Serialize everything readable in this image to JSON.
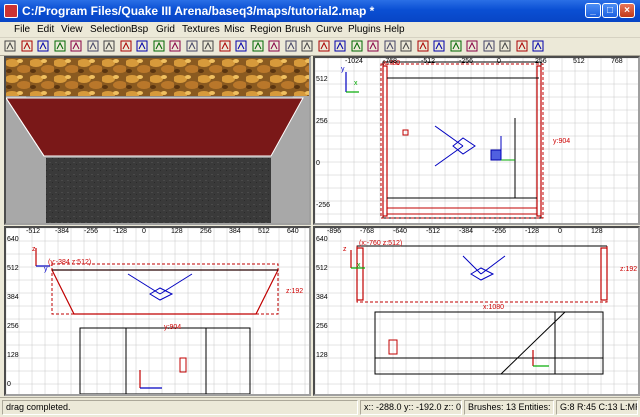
{
  "window": {
    "title": "C:/Program Files/Quake III Arena/baseq3/maps/tutorial2.map *",
    "minimize": "_",
    "maximize": "□",
    "close": "×"
  },
  "menu": [
    "File",
    "Edit",
    "View",
    "Selection",
    "Bsp",
    "Grid",
    "Textures",
    "Misc",
    "Region",
    "Brush",
    "Curve",
    "Plugins",
    "Help"
  ],
  "toolbar_icons": [
    "open-icon",
    "save-icon",
    "flip-x-icon",
    "flip-y-icon",
    "flip-z-icon",
    "rotate-x-icon",
    "rotate-y-icon",
    "rotate-z-icon",
    "select-complete-icon",
    "select-touching-icon",
    "select-partial-icon",
    "select-inside-icon",
    "csg-subtract-icon",
    "csg-merge-icon",
    "hollow-icon",
    "clipper-icon",
    "change-view-icon",
    "texture-view-icon",
    "camera-icon",
    "free-rotate-icon",
    "scale-x-icon",
    "scale-y-icon",
    "scale-z-icon",
    "patch-icon",
    "bevel-icon",
    "endcap-icon",
    "cone-icon",
    "sphere-icon",
    "brush-icon",
    "drag-edges-icon",
    "drag-vertex-icon",
    "show-patch-icon",
    "bend-icon"
  ],
  "views": {
    "top": {
      "x_ticks": [
        "-1024",
        "-768",
        "-512",
        "-256",
        "0",
        "256",
        "512",
        "768"
      ],
      "y_ticks": [
        "512",
        "256",
        "0",
        "-256"
      ],
      "dim_x": "x:760",
      "dim_y": "y:904",
      "axis_labels": [
        "x",
        "y"
      ]
    },
    "front": {
      "x_ticks": [
        "-512",
        "-384",
        "-256",
        "-128",
        "0",
        "128",
        "256",
        "384",
        "512",
        "640"
      ],
      "y_ticks": [
        "640",
        "512",
        "384",
        "256",
        "128",
        "0"
      ],
      "dim_top": "(y:-384 z:512)",
      "dim_bottom": "y:904",
      "dim_right": "z:192",
      "axis_labels": [
        "z",
        "y"
      ]
    },
    "side": {
      "x_ticks": [
        "-896",
        "-768",
        "-640",
        "-512",
        "-384",
        "-256",
        "-128",
        "0",
        "128"
      ],
      "y_ticks": [
        "640",
        "512",
        "384",
        "256",
        "128"
      ],
      "dim_top": "(x:-760 z:512)",
      "dim_bottom": "x:1080",
      "dim_right": "z:192",
      "axis_labels": [
        "z",
        "x"
      ]
    }
  },
  "status": {
    "message": "drag completed.",
    "coords": "x:: -288.0  y:: -192.0  z:: 0.0",
    "counts": "Brushes: 13 Entities: 1",
    "grid": "G:8 R:45 C:13 L:MR"
  },
  "colors": {
    "selected_brush": "#c00000",
    "grid_line": "#c8c8c8",
    "brush_outline": "#000000",
    "entity": "#0000c0",
    "title_bar": "#0a4fd3"
  }
}
